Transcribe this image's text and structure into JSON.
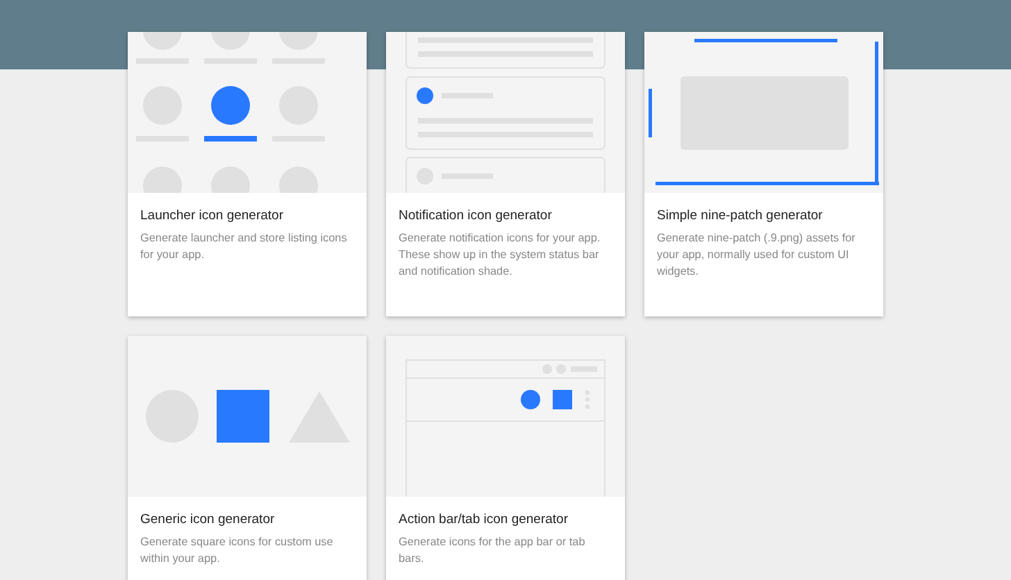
{
  "cards": [
    {
      "kind": "launcher",
      "title": "Launcher icon generator",
      "description": "Generate launcher and store listing icons for your app."
    },
    {
      "kind": "notification",
      "title": "Notification icon generator",
      "description": "Generate notification icons for your app. These show up in the system status bar and notification shade."
    },
    {
      "kind": "ninepatch",
      "title": "Simple nine-patch generator",
      "description": "Generate nine-patch (.9.png) assets for your app, normally used for custom UI widgets."
    },
    {
      "kind": "generic",
      "title": "Generic icon generator",
      "description": "Generate square icons for custom use within your app."
    },
    {
      "kind": "actionbar",
      "title": "Action bar/tab icon generator",
      "description": "Generate icons for the app bar or tab bars."
    }
  ]
}
